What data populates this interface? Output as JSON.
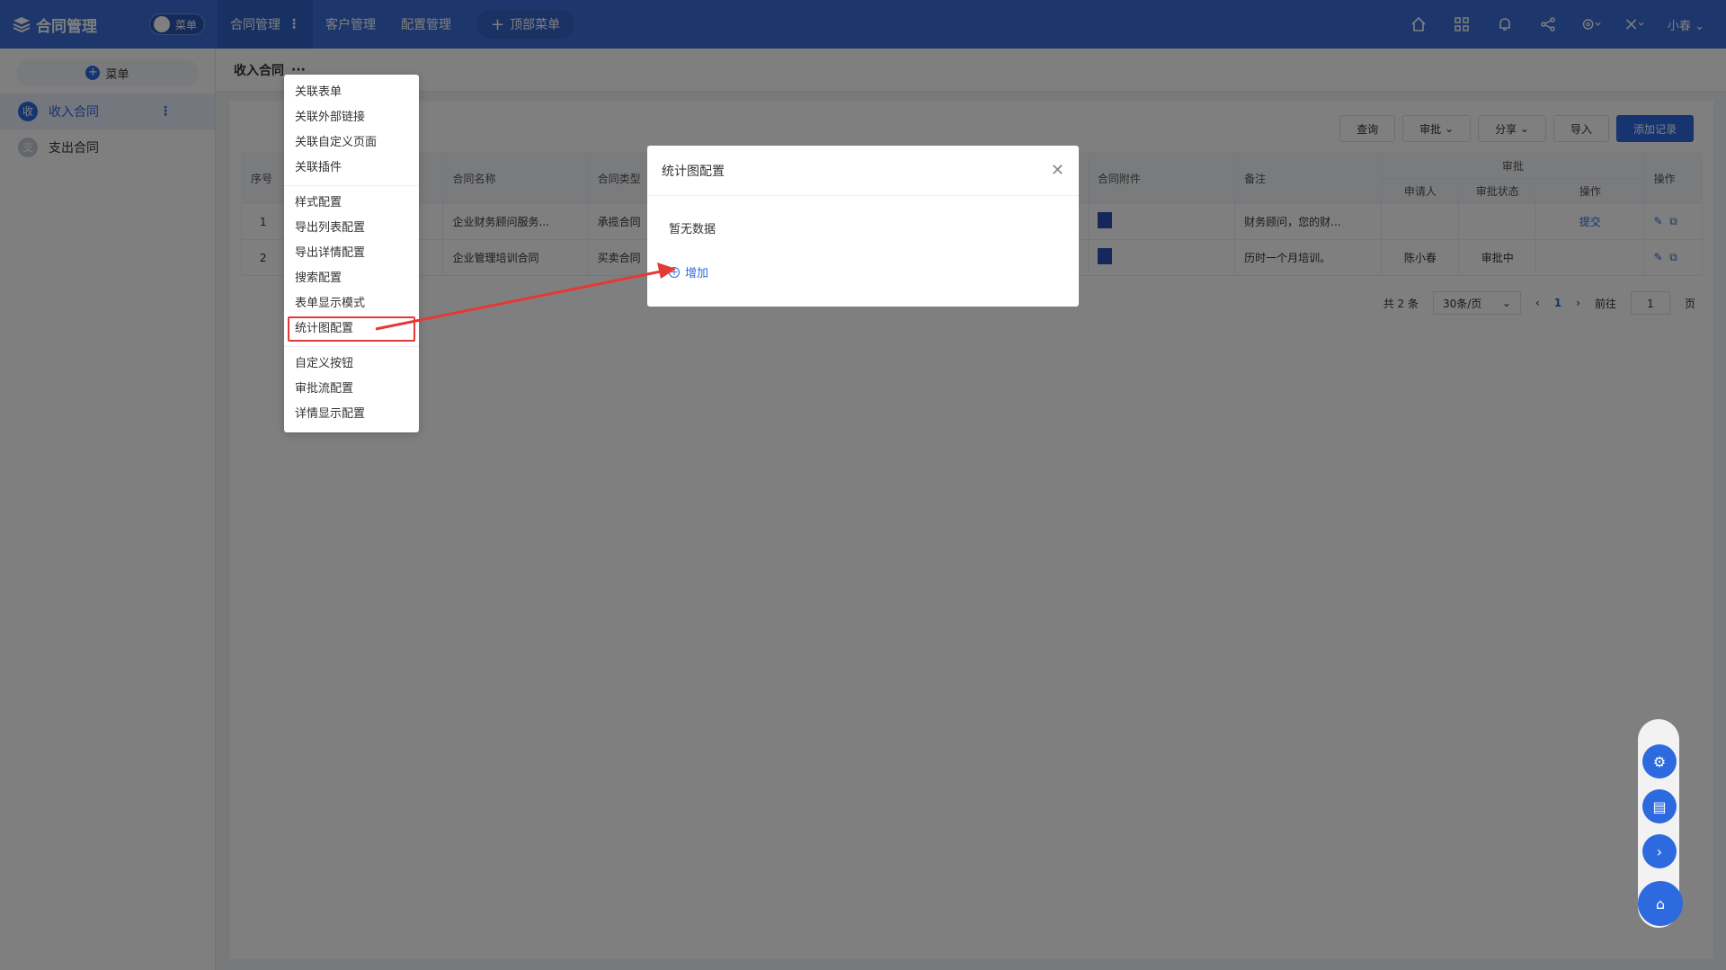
{
  "app": {
    "title": "合同管理",
    "toggle_label": "菜单"
  },
  "topnav": {
    "items": [
      {
        "label": "合同管理"
      },
      {
        "label": "客户管理"
      },
      {
        "label": "配置管理"
      }
    ],
    "add_label": "顶部菜单",
    "user": "小春"
  },
  "sidebar": {
    "menu_label": "菜单",
    "items": [
      {
        "badge": "收",
        "label": "收入合同"
      },
      {
        "badge": "支",
        "label": "支出合同"
      }
    ]
  },
  "breadcrumb": {
    "title": "收入合同",
    "more": "···"
  },
  "toolbar": {
    "query": "查询",
    "approve": "审批",
    "share": "分享",
    "import": "导入",
    "add": "添加记录"
  },
  "table": {
    "headers": {
      "index": "序号",
      "name": "合同名称",
      "type": "合同类型",
      "attach": "合同附件",
      "note": "备注",
      "approval_group": "审批",
      "applicant": "申请人",
      "status": "审批状态",
      "op": "操作",
      "action": "操作"
    },
    "rows": [
      {
        "index": "1",
        "name": "企业财务顾问服务...",
        "type": "承揽合同",
        "note": "财务顾问，您的财...",
        "applicant": "",
        "status": "",
        "op": "提交"
      },
      {
        "index": "2",
        "name": "企业管理培训合同",
        "type": "买卖合同",
        "note": "历时一个月培训。",
        "applicant": "陈小春",
        "status": "审批中",
        "op": ""
      }
    ]
  },
  "pager": {
    "total": "共 2 条",
    "page_size": "30条/页",
    "current": "1",
    "goto": "前往",
    "goto_value": "1",
    "page_unit": "页"
  },
  "dropdown": {
    "items": [
      "关联表单",
      "关联外部链接",
      "关联自定义页面",
      "关联插件",
      "样式配置",
      "导出列表配置",
      "导出详情配置",
      "搜索配置",
      "表单显示模式",
      "统计图配置",
      "自定义按钮",
      "审批流配置",
      "详情显示配置"
    ]
  },
  "modal": {
    "title": "统计图配置",
    "empty": "暂无数据",
    "add": "增加"
  },
  "colors": {
    "primary": "#2d6ae0",
    "topbar": "#3a6fd8",
    "highlight": "#e53935"
  }
}
